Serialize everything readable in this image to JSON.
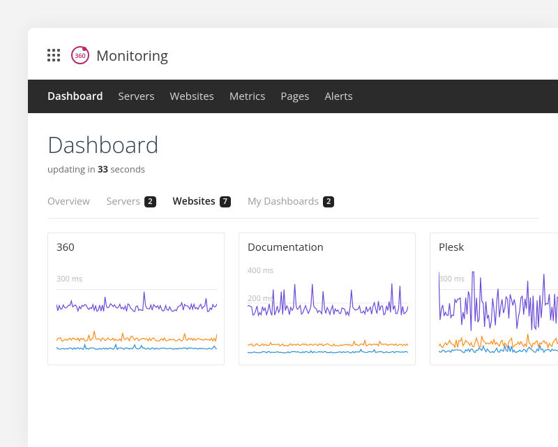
{
  "brand": {
    "name": "Monitoring"
  },
  "nav": [
    {
      "label": "Dashboard",
      "active": true
    },
    {
      "label": "Servers"
    },
    {
      "label": "Websites"
    },
    {
      "label": "Metrics"
    },
    {
      "label": "Pages"
    },
    {
      "label": "Alerts"
    }
  ],
  "page": {
    "title": "Dashboard",
    "updating_prefix": "updating in ",
    "updating_value": "33",
    "updating_suffix": " seconds"
  },
  "tabs": [
    {
      "label": "Overview"
    },
    {
      "label": "Servers",
      "badge": "2"
    },
    {
      "label": "Websites",
      "badge": "7",
      "active": true
    },
    {
      "label": "My Dashboards",
      "badge": "2"
    }
  ],
  "charts": [
    {
      "title": "360",
      "y_labels": [
        "300 ms"
      ]
    },
    {
      "title": "Documentation",
      "y_labels": [
        "400 ms",
        "200 ms"
      ]
    },
    {
      "title": "Plesk",
      "y_labels": [
        "300 ms"
      ]
    }
  ],
  "colors": {
    "purple": "#6a4bd8",
    "orange": "#ff8c1a",
    "blue": "#2d8fd8"
  },
  "chart_data": [
    {
      "type": "line",
      "title": "360",
      "ylabel": "ms",
      "ylim": [
        0,
        400
      ],
      "x": "time (unlabeled)",
      "series": [
        {
          "name": "purple",
          "baseline": 220,
          "range": [
            180,
            320
          ]
        },
        {
          "name": "orange",
          "baseline": 80,
          "range": [
            60,
            120
          ]
        },
        {
          "name": "blue",
          "baseline": 40,
          "range": [
            30,
            60
          ]
        }
      ]
    },
    {
      "type": "line",
      "title": "Documentation",
      "ylabel": "ms",
      "ylim": [
        0,
        500
      ],
      "x": "time (unlabeled)",
      "series": [
        {
          "name": "purple",
          "baseline": 260,
          "range": [
            200,
            420
          ]
        },
        {
          "name": "orange",
          "baseline": 70,
          "range": [
            50,
            100
          ]
        },
        {
          "name": "blue",
          "baseline": 30,
          "range": [
            20,
            50
          ]
        }
      ]
    },
    {
      "type": "line",
      "title": "Plesk",
      "ylabel": "ms",
      "ylim": [
        0,
        400
      ],
      "x": "time (unlabeled)",
      "series": [
        {
          "name": "purple",
          "baseline": 200,
          "range": [
            60,
            360
          ]
        },
        {
          "name": "orange",
          "baseline": 60,
          "range": [
            40,
            100
          ]
        },
        {
          "name": "blue",
          "baseline": 30,
          "range": [
            20,
            50
          ]
        }
      ]
    }
  ]
}
